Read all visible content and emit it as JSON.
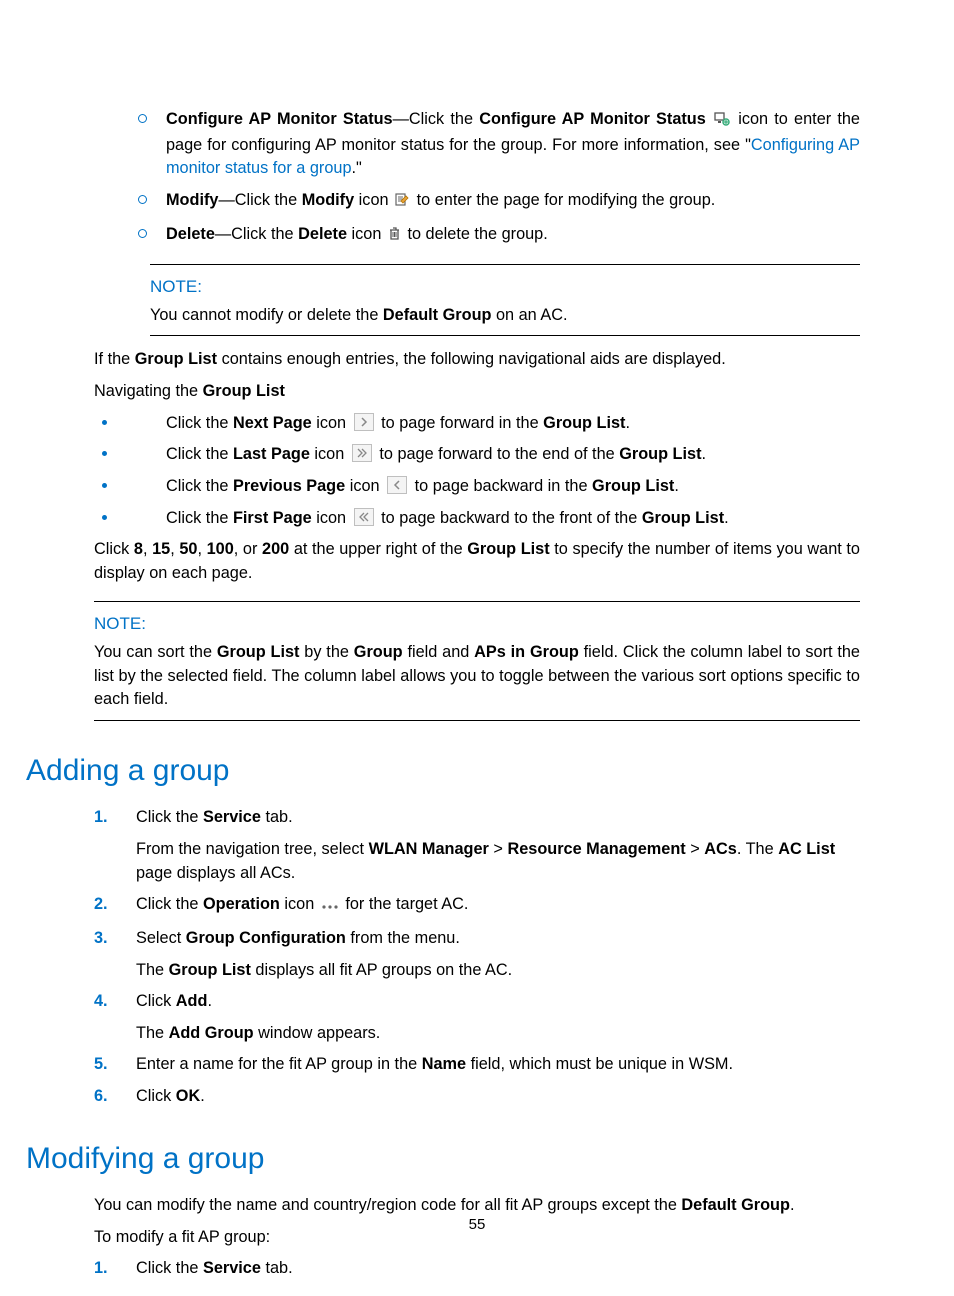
{
  "top_list": {
    "items": [
      {
        "label": "Configure AP Monitor Status",
        "pre": "—Click the ",
        "action_bold": "Configure AP Monitor Status",
        "mid": " ",
        "icon": "monitor",
        "post": " icon to enter the page for configuring AP monitor status for the group. For more information, see \"",
        "link_text": "Configuring AP monitor status for a group",
        "end": ".\""
      },
      {
        "label": "Modify",
        "pre": "—Click the ",
        "action_bold": "Modify",
        "mid": " icon ",
        "icon": "edit",
        "post": " to enter the page for modifying the group."
      },
      {
        "label": "Delete",
        "pre": "—Click the ",
        "action_bold": "Delete",
        "mid": " icon ",
        "icon": "trash",
        "post": " to delete the group."
      }
    ]
  },
  "note1": {
    "label": "NOTE:",
    "text_pre": "You cannot modify or delete the ",
    "bold": "Default Group",
    "text_post": " on an AC."
  },
  "para1": {
    "pre": "If the ",
    "bold": "Group List",
    "post": " contains enough entries, the following navigational aids are displayed."
  },
  "para2": {
    "pre": "Navigating the ",
    "bold": "Group List"
  },
  "nav_list": [
    {
      "pre": "Click the ",
      "bold": "Next Page",
      "mid": " icon ",
      "icon": "next",
      "post1": " to page forward in the ",
      "bold2": "Group List",
      "end": "."
    },
    {
      "pre": "Click the ",
      "bold": "Last Page",
      "mid": " icon ",
      "icon": "last",
      "post1": " to page forward to the end of the ",
      "bold2": "Group List",
      "end": "."
    },
    {
      "pre": "Click the ",
      "bold": "Previous Page",
      "mid": " icon ",
      "icon": "prev",
      "post1": " to page backward in the ",
      "bold2": "Group List",
      "end": "."
    },
    {
      "pre": "Click the ",
      "bold": "First Page",
      "mid": " icon ",
      "icon": "first",
      "post1": " to page backward to the front of the ",
      "bold2": "Group List",
      "end": "."
    }
  ],
  "para3": {
    "p1": "Click ",
    "b1": "8",
    "c1": ", ",
    "b2": "15",
    "c2": ", ",
    "b3": "50",
    "c3": ", ",
    "b4": "100",
    "c4": ", or ",
    "b5": "200",
    "p2": " at the upper right of the ",
    "b6": "Group List",
    "p3": " to specify the number of items you want to display on each page."
  },
  "note2": {
    "label": "NOTE:",
    "t1": "You can sort the ",
    "b1": "Group List",
    "t2": " by the ",
    "b2": "Group",
    "t3": " field and ",
    "b3": "APs in Group",
    "t4": " field. Click the column label to sort the list by the selected field. The column label allows you to toggle between the various sort options specific to each field."
  },
  "h_adding": "Adding a group",
  "adding_steps": [
    {
      "marker": "1.",
      "lines": [
        {
          "kind": "line",
          "segs": [
            {
              "t": "Click the "
            },
            {
              "b": "Service"
            },
            {
              "t": " tab."
            }
          ]
        },
        {
          "kind": "line",
          "segs": [
            {
              "t": "From the navigation tree, select "
            },
            {
              "b": "WLAN Manager"
            },
            {
              "t": " > "
            },
            {
              "b": "Resource Management"
            },
            {
              "t": " > "
            },
            {
              "b": "ACs"
            },
            {
              "t": ". The "
            },
            {
              "b": "AC List"
            },
            {
              "t": " page displays all ACs."
            }
          ]
        }
      ]
    },
    {
      "marker": "2.",
      "lines": [
        {
          "kind": "icon_line",
          "segs_before": [
            {
              "t": "Click the "
            },
            {
              "b": "Operation"
            },
            {
              "t": " icon "
            }
          ],
          "icon": "dots",
          "segs_after": [
            {
              "t": " for the target AC."
            }
          ]
        }
      ]
    },
    {
      "marker": "3.",
      "lines": [
        {
          "kind": "line",
          "segs": [
            {
              "t": "Select "
            },
            {
              "b": "Group Configuration"
            },
            {
              "t": " from the menu."
            }
          ]
        },
        {
          "kind": "line",
          "segs": [
            {
              "t": "The "
            },
            {
              "b": "Group List"
            },
            {
              "t": " displays all fit AP groups on the AC."
            }
          ]
        }
      ]
    },
    {
      "marker": "4.",
      "lines": [
        {
          "kind": "line",
          "segs": [
            {
              "t": "Click "
            },
            {
              "b": "Add"
            },
            {
              "t": "."
            }
          ]
        },
        {
          "kind": "line",
          "segs": [
            {
              "t": "The "
            },
            {
              "b": "Add Group"
            },
            {
              "t": " window appears."
            }
          ]
        }
      ]
    },
    {
      "marker": "5.",
      "lines": [
        {
          "kind": "line",
          "segs": [
            {
              "t": "Enter a name for the fit AP group in the "
            },
            {
              "b": "Name"
            },
            {
              "t": " field, which must be unique in WSM."
            }
          ]
        }
      ]
    },
    {
      "marker": "6.",
      "lines": [
        {
          "kind": "line",
          "segs": [
            {
              "t": "Click "
            },
            {
              "b": "OK"
            },
            {
              "t": "."
            }
          ]
        }
      ]
    }
  ],
  "h_modifying": "Modifying a group",
  "mod_intro": {
    "t1": "You can modify the name and country/region code for all fit AP groups except the ",
    "b1": "Default Group",
    "t2": "."
  },
  "mod_intro2": "To modify a fit AP group:",
  "mod_steps": [
    {
      "marker": "1.",
      "lines": [
        {
          "kind": "line",
          "segs": [
            {
              "t": "Click the "
            },
            {
              "b": "Service"
            },
            {
              "t": " tab."
            }
          ]
        }
      ]
    }
  ],
  "page_number": "55"
}
